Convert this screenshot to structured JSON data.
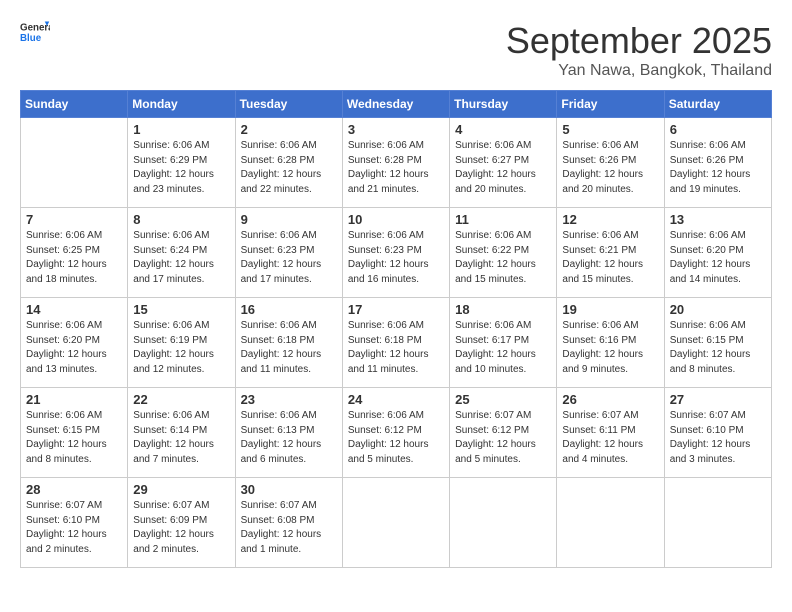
{
  "header": {
    "logo_general": "General",
    "logo_blue": "Blue",
    "month": "September 2025",
    "location": "Yan Nawa, Bangkok, Thailand"
  },
  "weekdays": [
    "Sunday",
    "Monday",
    "Tuesday",
    "Wednesday",
    "Thursday",
    "Friday",
    "Saturday"
  ],
  "weeks": [
    [
      {
        "date": "",
        "info": ""
      },
      {
        "date": "1",
        "info": "Sunrise: 6:06 AM\nSunset: 6:29 PM\nDaylight: 12 hours\nand 23 minutes."
      },
      {
        "date": "2",
        "info": "Sunrise: 6:06 AM\nSunset: 6:28 PM\nDaylight: 12 hours\nand 22 minutes."
      },
      {
        "date": "3",
        "info": "Sunrise: 6:06 AM\nSunset: 6:28 PM\nDaylight: 12 hours\nand 21 minutes."
      },
      {
        "date": "4",
        "info": "Sunrise: 6:06 AM\nSunset: 6:27 PM\nDaylight: 12 hours\nand 20 minutes."
      },
      {
        "date": "5",
        "info": "Sunrise: 6:06 AM\nSunset: 6:26 PM\nDaylight: 12 hours\nand 20 minutes."
      },
      {
        "date": "6",
        "info": "Sunrise: 6:06 AM\nSunset: 6:26 PM\nDaylight: 12 hours\nand 19 minutes."
      }
    ],
    [
      {
        "date": "7",
        "info": "Sunrise: 6:06 AM\nSunset: 6:25 PM\nDaylight: 12 hours\nand 18 minutes."
      },
      {
        "date": "8",
        "info": "Sunrise: 6:06 AM\nSunset: 6:24 PM\nDaylight: 12 hours\nand 17 minutes."
      },
      {
        "date": "9",
        "info": "Sunrise: 6:06 AM\nSunset: 6:23 PM\nDaylight: 12 hours\nand 17 minutes."
      },
      {
        "date": "10",
        "info": "Sunrise: 6:06 AM\nSunset: 6:23 PM\nDaylight: 12 hours\nand 16 minutes."
      },
      {
        "date": "11",
        "info": "Sunrise: 6:06 AM\nSunset: 6:22 PM\nDaylight: 12 hours\nand 15 minutes."
      },
      {
        "date": "12",
        "info": "Sunrise: 6:06 AM\nSunset: 6:21 PM\nDaylight: 12 hours\nand 15 minutes."
      },
      {
        "date": "13",
        "info": "Sunrise: 6:06 AM\nSunset: 6:20 PM\nDaylight: 12 hours\nand 14 minutes."
      }
    ],
    [
      {
        "date": "14",
        "info": "Sunrise: 6:06 AM\nSunset: 6:20 PM\nDaylight: 12 hours\nand 13 minutes."
      },
      {
        "date": "15",
        "info": "Sunrise: 6:06 AM\nSunset: 6:19 PM\nDaylight: 12 hours\nand 12 minutes."
      },
      {
        "date": "16",
        "info": "Sunrise: 6:06 AM\nSunset: 6:18 PM\nDaylight: 12 hours\nand 11 minutes."
      },
      {
        "date": "17",
        "info": "Sunrise: 6:06 AM\nSunset: 6:18 PM\nDaylight: 12 hours\nand 11 minutes."
      },
      {
        "date": "18",
        "info": "Sunrise: 6:06 AM\nSunset: 6:17 PM\nDaylight: 12 hours\nand 10 minutes."
      },
      {
        "date": "19",
        "info": "Sunrise: 6:06 AM\nSunset: 6:16 PM\nDaylight: 12 hours\nand 9 minutes."
      },
      {
        "date": "20",
        "info": "Sunrise: 6:06 AM\nSunset: 6:15 PM\nDaylight: 12 hours\nand 8 minutes."
      }
    ],
    [
      {
        "date": "21",
        "info": "Sunrise: 6:06 AM\nSunset: 6:15 PM\nDaylight: 12 hours\nand 8 minutes."
      },
      {
        "date": "22",
        "info": "Sunrise: 6:06 AM\nSunset: 6:14 PM\nDaylight: 12 hours\nand 7 minutes."
      },
      {
        "date": "23",
        "info": "Sunrise: 6:06 AM\nSunset: 6:13 PM\nDaylight: 12 hours\nand 6 minutes."
      },
      {
        "date": "24",
        "info": "Sunrise: 6:06 AM\nSunset: 6:12 PM\nDaylight: 12 hours\nand 5 minutes."
      },
      {
        "date": "25",
        "info": "Sunrise: 6:07 AM\nSunset: 6:12 PM\nDaylight: 12 hours\nand 5 minutes."
      },
      {
        "date": "26",
        "info": "Sunrise: 6:07 AM\nSunset: 6:11 PM\nDaylight: 12 hours\nand 4 minutes."
      },
      {
        "date": "27",
        "info": "Sunrise: 6:07 AM\nSunset: 6:10 PM\nDaylight: 12 hours\nand 3 minutes."
      }
    ],
    [
      {
        "date": "28",
        "info": "Sunrise: 6:07 AM\nSunset: 6:10 PM\nDaylight: 12 hours\nand 2 minutes."
      },
      {
        "date": "29",
        "info": "Sunrise: 6:07 AM\nSunset: 6:09 PM\nDaylight: 12 hours\nand 2 minutes."
      },
      {
        "date": "30",
        "info": "Sunrise: 6:07 AM\nSunset: 6:08 PM\nDaylight: 12 hours\nand 1 minute."
      },
      {
        "date": "",
        "info": ""
      },
      {
        "date": "",
        "info": ""
      },
      {
        "date": "",
        "info": ""
      },
      {
        "date": "",
        "info": ""
      }
    ]
  ]
}
